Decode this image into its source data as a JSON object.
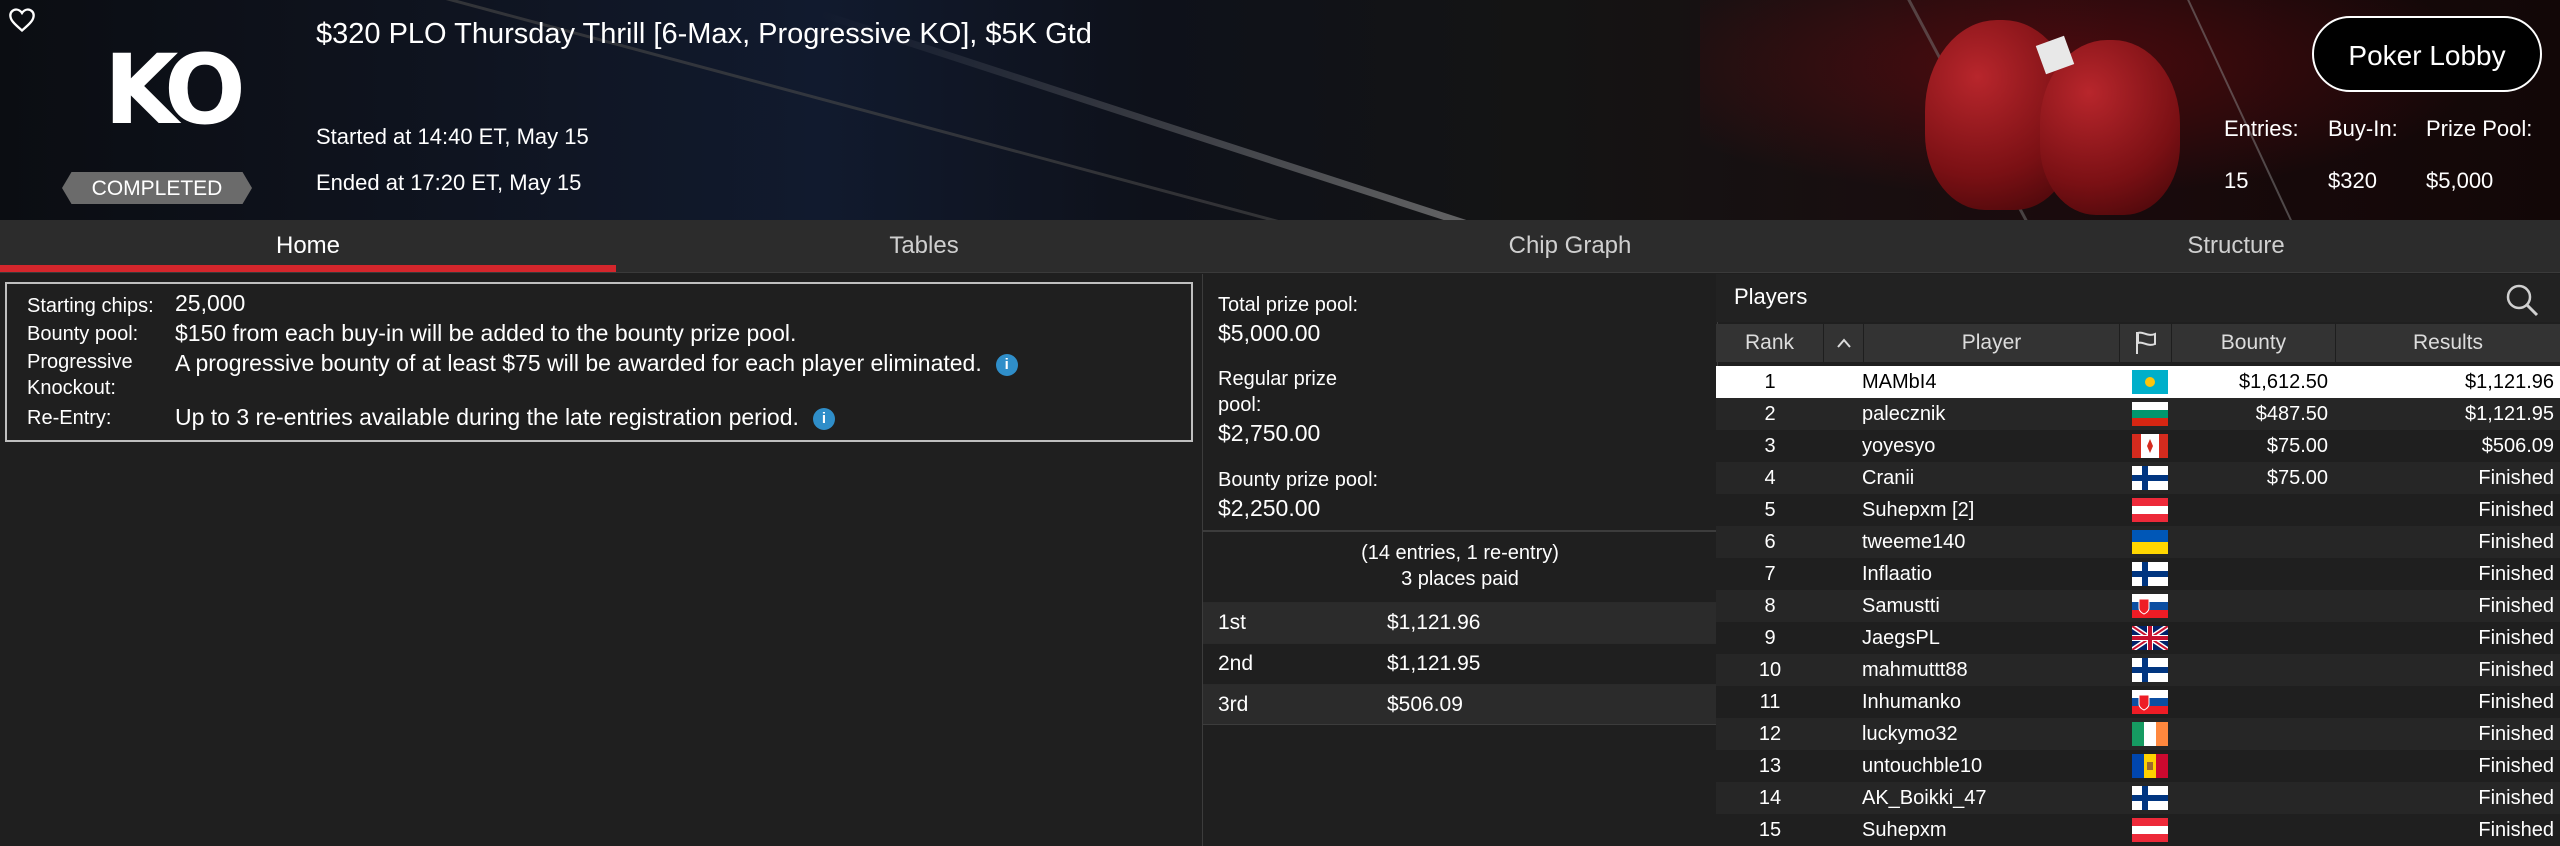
{
  "header": {
    "title": "$320 PLO Thursday Thrill [6-Max, Progressive KO], $5K Gtd",
    "started": "Started at 14:40 ET, May 15",
    "ended": "Ended at 17:20 ET, May 15",
    "status_badge": "COMPLETED",
    "logo_text": "KO",
    "lobby_button": "Poker Lobby",
    "stats": {
      "entries_label": "Entries:",
      "entries_value": "15",
      "buyin_label": "Buy-In:",
      "buyin_value": "$320",
      "prizepool_label": "Prize Pool:",
      "prizepool_value": "$5,000"
    }
  },
  "tabs": [
    {
      "label": "Home",
      "active": true
    },
    {
      "label": "Tables"
    },
    {
      "label": "Chip Graph"
    },
    {
      "label": "Structure"
    }
  ],
  "info": {
    "starting_chips_label": "Starting chips:",
    "starting_chips_value": "25,000",
    "bounty_pool_label": "Bounty pool:",
    "bounty_pool_value": "$150 from each buy-in will be added to the bounty prize pool.",
    "pko_label_1": "Progressive",
    "pko_label_2": "Knockout:",
    "pko_value": "A progressive bounty of at least $75 will be awarded for each player eliminated.",
    "reentry_label": "Re-Entry:",
    "reentry_value": "Up to 3 re-entries available during the late registration period."
  },
  "prize": {
    "total_label": "Total prize pool:",
    "total_value": "$5,000.00",
    "regular_label_1": "Regular prize",
    "regular_label_2": "pool:",
    "regular_value": "$2,750.00",
    "bounty_label": "Bounty prize pool:",
    "bounty_value": "$2,250.00",
    "entries_note": "(14 entries, 1 re-entry)",
    "places_note": "3 places paid",
    "places": [
      {
        "place": "1st",
        "amount": "$1,121.96"
      },
      {
        "place": "2nd",
        "amount": "$1,121.95"
      },
      {
        "place": "3rd",
        "amount": "$506.09"
      }
    ]
  },
  "players": {
    "title": "Players",
    "columns": {
      "rank": "Rank",
      "player": "Player",
      "bounty": "Bounty",
      "results": "Results"
    },
    "rows": [
      {
        "rank": "1",
        "name": "MAMbI4",
        "flag": "kz-flag",
        "bounty": "$1,612.50",
        "result": "$1,121.96"
      },
      {
        "rank": "2",
        "name": "palecznik",
        "flag": "bg-flag",
        "bounty": "$487.50",
        "result": "$1,121.95"
      },
      {
        "rank": "3",
        "name": "yoyesyo",
        "flag": "ca-flag",
        "bounty": "$75.00",
        "result": "$506.09"
      },
      {
        "rank": "4",
        "name": "Cranii",
        "flag": "fi-flag",
        "bounty": "$75.00",
        "result": "Finished"
      },
      {
        "rank": "5",
        "name": "Suhepxm [2]",
        "flag": "at-flag",
        "bounty": "",
        "result": "Finished"
      },
      {
        "rank": "6",
        "name": "tweeme140",
        "flag": "ua-flag",
        "bounty": "",
        "result": "Finished"
      },
      {
        "rank": "7",
        "name": "Inflaatio",
        "flag": "fi-flag",
        "bounty": "",
        "result": "Finished"
      },
      {
        "rank": "8",
        "name": "Samustti",
        "flag": "sk-flag",
        "bounty": "",
        "result": "Finished"
      },
      {
        "rank": "9",
        "name": "JaegsPL",
        "flag": "gb-flag",
        "bounty": "",
        "result": "Finished"
      },
      {
        "rank": "10",
        "name": "mahmuttt88",
        "flag": "fi-flag",
        "bounty": "",
        "result": "Finished"
      },
      {
        "rank": "11",
        "name": "Inhumanko",
        "flag": "sk-flag",
        "bounty": "",
        "result": "Finished"
      },
      {
        "rank": "12",
        "name": "luckymo32",
        "flag": "ie-flag",
        "bounty": "",
        "result": "Finished"
      },
      {
        "rank": "13",
        "name": "untouchble10",
        "flag": "md-flag",
        "bounty": "",
        "result": "Finished"
      },
      {
        "rank": "14",
        "name": "AK_Boikki_47",
        "flag": "fi-flag",
        "bounty": "",
        "result": "Finished"
      },
      {
        "rank": "15",
        "name": "Suhepxm",
        "flag": "at-flag",
        "bounty": "",
        "result": "Finished"
      }
    ]
  },
  "colors": {
    "accent_red": "#d4262c",
    "info_blue": "#2f8ec9",
    "panel_bg": "#1f1f1f"
  }
}
